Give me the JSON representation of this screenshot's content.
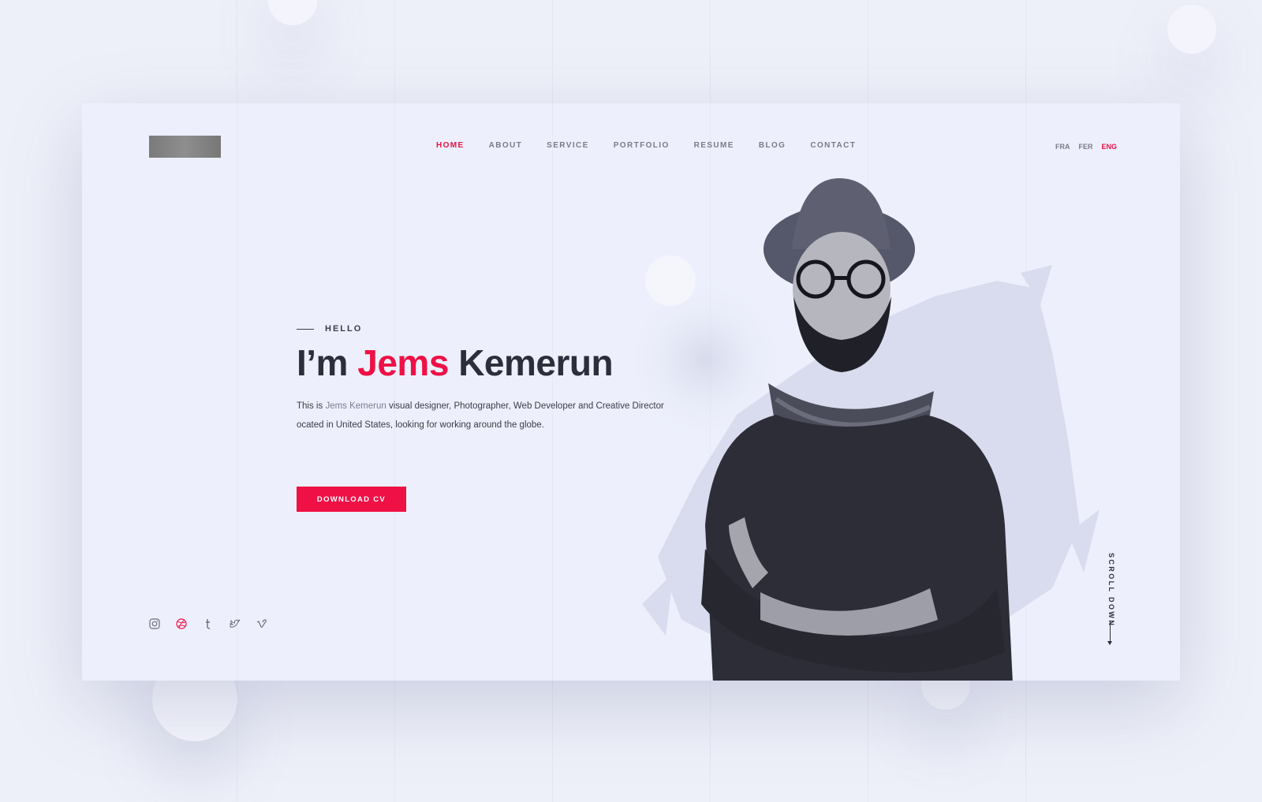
{
  "logo": {
    "alt": "logo (pixelated)"
  },
  "nav": {
    "items": [
      {
        "label": "HOME",
        "active": true
      },
      {
        "label": "ABOUT"
      },
      {
        "label": "SERVICE"
      },
      {
        "label": "PORTFOLIO"
      },
      {
        "label": "RESUME"
      },
      {
        "label": "BLOG"
      },
      {
        "label": "CONTACT"
      }
    ]
  },
  "languages": [
    {
      "label": "FRA"
    },
    {
      "label": "FER"
    },
    {
      "label": "ENG",
      "active": true
    }
  ],
  "hero": {
    "hello": "HELLO",
    "title_prefix": "I’m",
    "title_accent": "Jems",
    "title_suffix": "Kemerun",
    "desc_start": "This is",
    "desc_name": "Jems Kemerun",
    "desc_line1": "visual designer, Photographer, Web Developer and Creative Director",
    "desc_line2": "ocated in United States, looking for working around the globe."
  },
  "cta": {
    "label": "DOWNLOAD CV"
  },
  "social": [
    "instagram-icon",
    "dribbble-icon",
    "tumblr-icon",
    "twitter-icon",
    "vimeo-icon"
  ],
  "scroll": {
    "label": "SCROLL DOWN"
  },
  "colors": {
    "accent": "#ef1046",
    "text_dark": "#2c2e3c",
    "text_muted": "#7a7c88",
    "background": "#edf0fc"
  }
}
